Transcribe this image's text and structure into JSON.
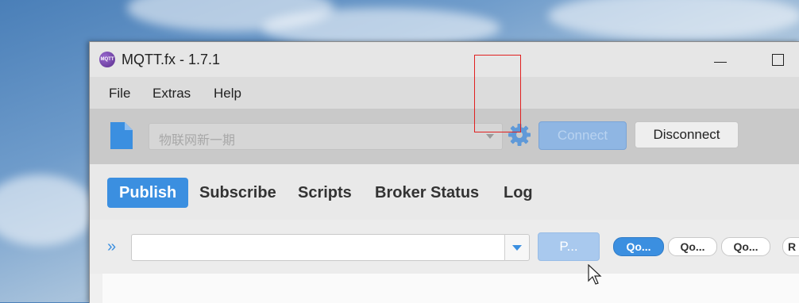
{
  "window": {
    "title": "MQTT.fx - 1.7.1",
    "app_icon_text": "MQTT"
  },
  "menu": [
    "File",
    "Extras",
    "Help"
  ],
  "toolbar": {
    "profile_placeholder": "物联网新一期",
    "connect_label": "Connect",
    "disconnect_label": "Disconnect"
  },
  "tabs": [
    "Publish",
    "Subscribe",
    "Scripts",
    "Broker Status",
    "Log"
  ],
  "publish": {
    "topic_value": "",
    "publish_label": "P...",
    "qos_options": [
      "Qo...",
      "Qo...",
      "Qo...",
      "R"
    ]
  },
  "colors": {
    "accent": "#3b8fe0",
    "highlight_box": "#e02020"
  }
}
